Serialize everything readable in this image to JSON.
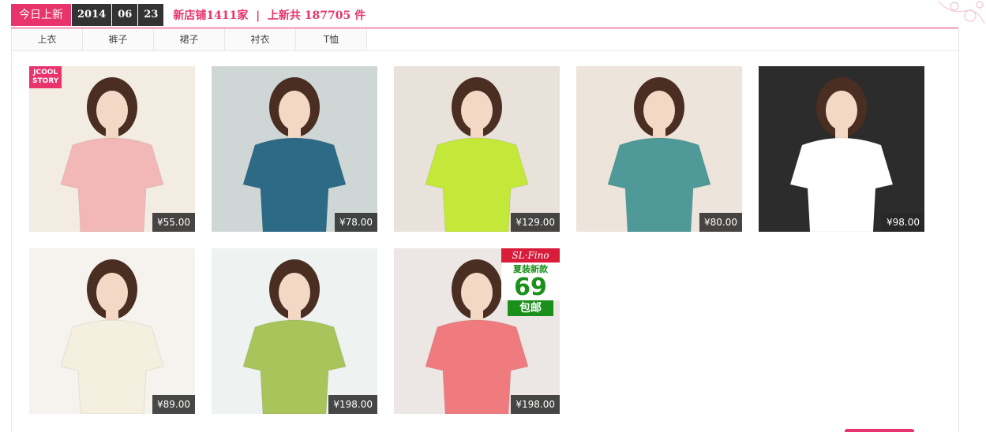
{
  "header": {
    "badge": "今日上新",
    "date": {
      "year": "2014",
      "month": "06",
      "day": "23"
    },
    "stats": "新店铺1411家  |  上新共 187705 件"
  },
  "tabs": [
    {
      "label": "上衣",
      "active": true
    },
    {
      "label": "裤子",
      "active": false
    },
    {
      "label": "裙子",
      "active": false
    },
    {
      "label": "衬衣",
      "active": false
    },
    {
      "label": "T恤",
      "active": false
    }
  ],
  "products": [
    {
      "price": "¥55.00",
      "shirt_color": "#f2b8b8",
      "bg": "#f3ece2",
      "logo": "JCOOL STORY"
    },
    {
      "price": "¥78.00",
      "shirt_color": "#2d6a86",
      "bg": "#cfd6d6"
    },
    {
      "price": "¥129.00",
      "shirt_color": "#c4e83a",
      "bg": "#e9e2da"
    },
    {
      "price": "¥80.00",
      "shirt_color": "#4f9a99",
      "bg": "#ede4dc"
    },
    {
      "price": "¥98.00",
      "shirt_color": "#ffffff",
      "bg": "#2c2c2c"
    },
    {
      "price": "¥89.00",
      "shirt_color": "#f5efe0",
      "bg": "#f6f3ee"
    },
    {
      "price": "¥198.00",
      "shirt_color": "#a8c45a",
      "bg": "#eef2f0"
    },
    {
      "price": "¥198.00",
      "shirt_color": "#f07b7e",
      "bg": "#ece6e4",
      "promo": {
        "brand": "SL·Fino",
        "sub": "夏装新款",
        "num": "69",
        "ship": "包邮"
      }
    }
  ]
}
